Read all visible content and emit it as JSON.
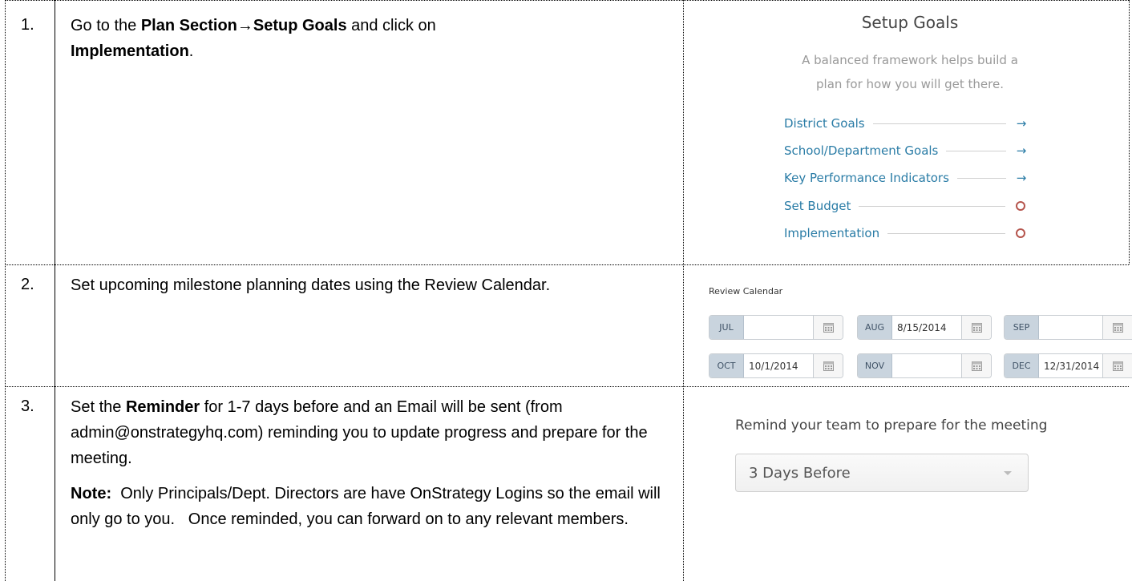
{
  "rows": [
    {
      "number": "1.",
      "text_parts": [
        "Go to the ",
        "Plan Section",
        "→",
        "Setup Goals",
        " and click on ",
        "Implementation",
        "."
      ]
    },
    {
      "number": "2.",
      "text": "Set upcoming milestone planning dates using the Review Calendar."
    },
    {
      "number": "3.",
      "text_parts": [
        "Set the ",
        "Reminder",
        " for 1-7 days before and an Email will be sent (from admin@onstrategyhq.com) reminding you to update progress and prepare for the meeting."
      ],
      "note_label": "Note:",
      "note_text": "  Only Principals/Dept. Directors are have OnStrategy Logins so the email will only go to you.   Once reminded, you can forward on to any relevant members."
    }
  ],
  "setup_goals": {
    "title": "Setup Goals",
    "description_line1": "A balanced framework helps build a",
    "description_line2": "plan for how you will get there.",
    "items": [
      {
        "label": "District Goals",
        "status_icon": "arrow-right-icon"
      },
      {
        "label": "School/Department Goals",
        "status_icon": "arrow-right-icon"
      },
      {
        "label": "Key Performance Indicators",
        "status_icon": "arrow-right-icon"
      },
      {
        "label": "Set Budget",
        "status_icon": "circle-icon"
      },
      {
        "label": "Implementation",
        "status_icon": "circle-icon"
      }
    ],
    "arrow_glyph": "→"
  },
  "review_calendar": {
    "title": "Review Calendar",
    "months": [
      {
        "month": "JUL",
        "date": ""
      },
      {
        "month": "AUG",
        "date": "8/15/2014"
      },
      {
        "month": "SEP",
        "date": ""
      },
      {
        "month": "OCT",
        "date": "10/1/2014"
      },
      {
        "month": "NOV",
        "date": ""
      },
      {
        "month": "DEC",
        "date": "12/31/2014"
      }
    ]
  },
  "reminder": {
    "label": "Remind your team to prepare for the meeting",
    "selected": "3 Days Before"
  },
  "colors": {
    "link": "#2a7ca6",
    "circle": "#b5544c",
    "month_bg": "#c9d4de"
  }
}
